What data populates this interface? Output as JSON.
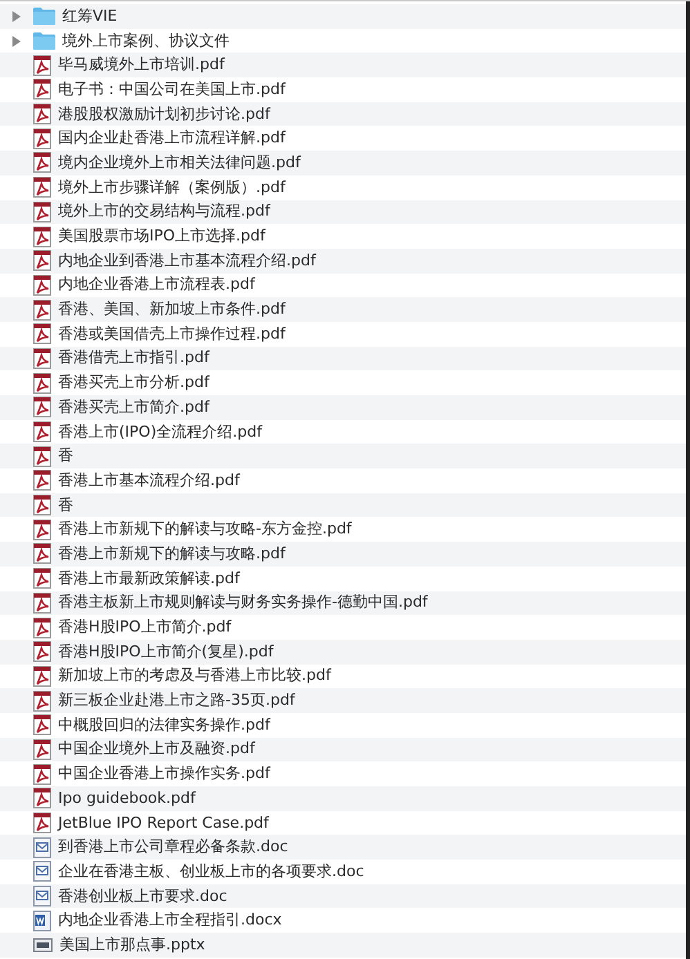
{
  "files": [
    {
      "kind": "folder",
      "name": "红筹VIE",
      "expanded": false
    },
    {
      "kind": "folder",
      "name": "境外上市案例、协议文件",
      "expanded": false
    },
    {
      "kind": "pdf",
      "name": "毕马威境外上市培训.pdf"
    },
    {
      "kind": "pdf",
      "name": "电子书：中国公司在美国上市.pdf"
    },
    {
      "kind": "pdf",
      "name": "港股股权激励计划初步讨论.pdf"
    },
    {
      "kind": "pdf",
      "name": "国内企业赴香港上市流程详解.pdf"
    },
    {
      "kind": "pdf",
      "name": "境内企业境外上市相关法律问题.pdf"
    },
    {
      "kind": "pdf",
      "name": "境外上市步骤详解（案例版）.pdf"
    },
    {
      "kind": "pdf",
      "name": "境外上市的交易结构与流程.pdf"
    },
    {
      "kind": "pdf",
      "name": "美国股票市场IPO上市选择.pdf"
    },
    {
      "kind": "pdf",
      "name": "内地企业到香港上市基本流程介绍.pdf"
    },
    {
      "kind": "pdf",
      "name": "内地企业香港上市流程表.pdf"
    },
    {
      "kind": "pdf",
      "name": "香港、美国、新加坡上市条件.pdf"
    },
    {
      "kind": "pdf",
      "name": "香港或美国借壳上市操作过程.pdf"
    },
    {
      "kind": "pdf",
      "name": "香港借壳上市指引.pdf"
    },
    {
      "kind": "pdf",
      "name": "香港买壳上市分析.pdf"
    },
    {
      "kind": "pdf",
      "name": "香港买壳上市简介.pdf"
    },
    {
      "kind": "pdf",
      "name": "香港上市(IPO)全流程介绍.pdf"
    },
    {
      "kind": "pdf",
      "name": "香"
    },
    {
      "kind": "pdf",
      "name": "香港上市基本流程介绍.pdf"
    },
    {
      "kind": "pdf",
      "name": "香"
    },
    {
      "kind": "pdf",
      "name": "香港上市新规下的解读与攻略-东方金控.pdf"
    },
    {
      "kind": "pdf",
      "name": "香港上市新规下的解读与攻略.pdf"
    },
    {
      "kind": "pdf",
      "name": "香港上市最新政策解读.pdf"
    },
    {
      "kind": "pdf",
      "name": "香港主板新上市规则解读与财务实务操作-德勤中国.pdf"
    },
    {
      "kind": "pdf",
      "name": "香港H股IPO上市简介.pdf"
    },
    {
      "kind": "pdf",
      "name": "香港H股IPO上市简介(复星).pdf"
    },
    {
      "kind": "pdf",
      "name": "新加坡上市的考虑及与香港上市比较.pdf"
    },
    {
      "kind": "pdf",
      "name": "新三板企业赴港上市之路-35页.pdf"
    },
    {
      "kind": "pdf",
      "name": "中概股回归的法律实务操作.pdf"
    },
    {
      "kind": "pdf",
      "name": "中国企业境外上市及融资.pdf"
    },
    {
      "kind": "pdf",
      "name": "中国企业香港上市操作实务.pdf"
    },
    {
      "kind": "pdf",
      "name": "Ipo guidebook.pdf"
    },
    {
      "kind": "pdf",
      "name": "JetBlue IPO Report Case.pdf"
    },
    {
      "kind": "doc",
      "name": "到香港上市公司章程必备条款.doc"
    },
    {
      "kind": "doc",
      "name": "企业在香港主板、创业板上市的各项要求.doc"
    },
    {
      "kind": "doc",
      "name": "香港创业板上市要求.doc"
    },
    {
      "kind": "docx",
      "name": "内地企业香港上市全程指引.docx"
    },
    {
      "kind": "pptx",
      "name": "美国上市那点事.pptx"
    }
  ]
}
